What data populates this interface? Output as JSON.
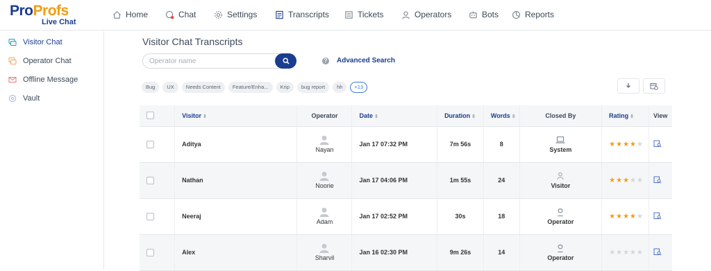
{
  "logo": {
    "brand_a": "Pro",
    "brand_b": "Profs",
    "product": "Live Chat"
  },
  "nav": {
    "items": [
      {
        "label": "Home",
        "icon": "home-icon"
      },
      {
        "label": "Chat",
        "icon": "chat-icon"
      },
      {
        "label": "Settings",
        "icon": "gear-icon"
      },
      {
        "label": "Transcripts",
        "icon": "transcript-icon"
      },
      {
        "label": "Tickets",
        "icon": "ticket-icon"
      },
      {
        "label": "Operators",
        "icon": "operator-icon"
      },
      {
        "label": "Bots",
        "icon": "bot-icon"
      },
      {
        "label": "Reports",
        "icon": "reports-icon"
      }
    ]
  },
  "sidebar": {
    "items": [
      {
        "label": "Visitor Chat",
        "icon": "visitor-chat-icon",
        "active": true
      },
      {
        "label": "Operator Chat",
        "icon": "operator-chat-icon",
        "active": false
      },
      {
        "label": "Offline Message",
        "icon": "envelope-icon",
        "active": false
      },
      {
        "label": "Vault",
        "icon": "vault-icon",
        "active": false
      }
    ]
  },
  "main": {
    "title": "Visitor Chat Transcripts",
    "search": {
      "placeholder": "Operator name",
      "value": ""
    },
    "help_glyph": "?",
    "advanced_search": "Advanced Search",
    "tags": [
      "Bug",
      "UX",
      "Needs Content",
      "Feature/Enha...",
      "Krip",
      "bug report",
      "hh"
    ],
    "tags_more": "+13"
  },
  "table": {
    "headers": {
      "visitor": "Visitor",
      "operator": "Operator",
      "date": "Date",
      "duration": "Duration",
      "words": "Words",
      "closed_by": "Closed By",
      "rating": "Rating",
      "view": "View"
    },
    "sort_glyph": "⇕",
    "rows": [
      {
        "visitor": "Aditya",
        "operator": "Nayan",
        "date": "Jan 17 07:32 PM",
        "duration": "7m 56s",
        "words": "8",
        "closed_by": "System",
        "closed_icon": "laptop-icon",
        "rating": 4
      },
      {
        "visitor": "Nathan",
        "operator": "Noorie",
        "date": "Jan 17 04:06 PM",
        "duration": "1m 55s",
        "words": "24",
        "closed_by": "Visitor",
        "closed_icon": "visitor-icon",
        "rating": 3
      },
      {
        "visitor": "Neeraj",
        "operator": "Adam",
        "date": "Jan 17 02:52 PM",
        "duration": "30s",
        "words": "18",
        "closed_by": "Operator",
        "closed_icon": "operator-icon",
        "rating": 4
      },
      {
        "visitor": "Alex",
        "operator": "Sharvil",
        "date": "Jan 16 02:30 PM",
        "duration": "9m 26s",
        "words": "14",
        "closed_by": "Operator",
        "closed_icon": "operator-icon",
        "rating": 0
      }
    ],
    "rating_max": 5
  },
  "colors": {
    "brand": "#1a3d8f",
    "brand_accent": "#f39c12",
    "star_on": "#f39c12",
    "star_off": "#d3d7dc",
    "link": "#3a7bd5"
  }
}
